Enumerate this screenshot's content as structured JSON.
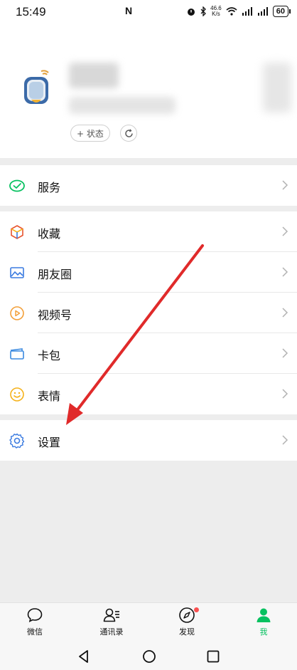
{
  "status_bar": {
    "time": "15:49",
    "nfc": "N",
    "speed_value": "46.6",
    "speed_unit": "K/s",
    "battery": "60"
  },
  "profile": {
    "status_button": "+ 状态"
  },
  "menu": {
    "group1": [
      {
        "label": "服务",
        "icon": "service-icon"
      }
    ],
    "group2": [
      {
        "label": "收藏",
        "icon": "favorites-icon"
      },
      {
        "label": "朋友圈",
        "icon": "moments-icon"
      },
      {
        "label": "视频号",
        "icon": "channels-icon"
      },
      {
        "label": "卡包",
        "icon": "cards-icon"
      },
      {
        "label": "表情",
        "icon": "sticker-icon"
      }
    ],
    "group3": [
      {
        "label": "设置",
        "icon": "gear-icon"
      }
    ]
  },
  "tabbar": {
    "tabs": [
      {
        "label": "微信",
        "icon": "chat-icon"
      },
      {
        "label": "通讯录",
        "icon": "contacts-icon"
      },
      {
        "label": "发现",
        "icon": "compass-icon"
      },
      {
        "label": "我",
        "icon": "person-icon"
      }
    ],
    "active_tab": "我"
  },
  "colors": {
    "accent_green": "#07c160",
    "arrow_red": "#e02a2a",
    "badge_red": "#fa5151"
  }
}
